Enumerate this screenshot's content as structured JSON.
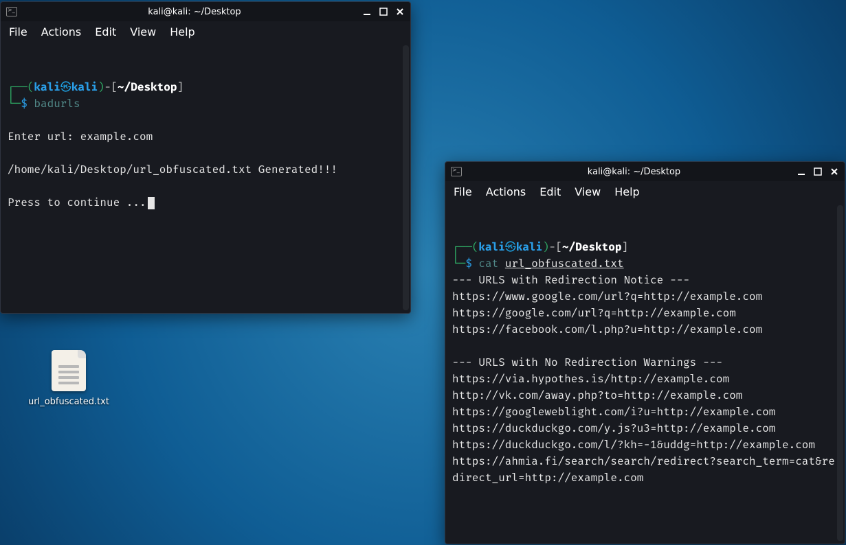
{
  "desktop": {
    "file_label": "url_obfuscated.txt"
  },
  "menu": {
    "file": "File",
    "actions": "Actions",
    "edit": "Edit",
    "view": "View",
    "help": "Help"
  },
  "win1": {
    "title": "kali@kali: ~/Desktop",
    "prompt_user": "kali",
    "prompt_host": "kali",
    "prompt_path": "~/Desktop",
    "cmd": "badurls",
    "out_line1": "Enter url: example.com",
    "out_line2": "/home/kali/Desktop/url_obfuscated.txt Generated!!!",
    "out_line3": "Press to continue ..."
  },
  "win2": {
    "title": "kali@kali: ~/Desktop",
    "prompt_user": "kali",
    "prompt_host": "kali",
    "prompt_path": "~/Desktop",
    "cmd": "cat ",
    "cmd_file": "url_obfuscated.txt",
    "lines": {
      "h1": "--- URLS with Redirection Notice ---",
      "u1": "https://www.google.com/url?q=http://example.com",
      "u2": "https://google.com/url?q=http://example.com",
      "u3": "https://facebook.com/l.php?u=http://example.com",
      "h2": "--- URLS with No Redirection Warnings ---",
      "u4": "https://via.hypothes.is/http://example.com",
      "u5": "http://vk.com/away.php?to=http://example.com",
      "u6": "https://googleweblight.com/i?u=http://example.com",
      "u7": "https://duckduckgo.com/y.js?u3=http://example.com",
      "u8": "https://duckduckgo.com/l/?kh=-1&uddg=http://example.com",
      "u9": "https://ahmia.fi/search/search/redirect?search_term=cat&redirect_url=http://example.com"
    }
  }
}
